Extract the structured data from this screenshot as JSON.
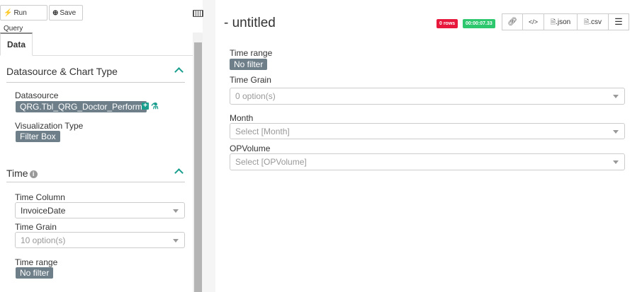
{
  "toolbar": {
    "run_query": "Run Query",
    "save": "Save"
  },
  "tabs": {
    "data": "Data"
  },
  "sections": {
    "datasource": {
      "title": "Datasource & Chart Type",
      "datasource_label": "Datasource",
      "datasource_value": "QRG.Tbl_QRG_Doctor_Perform",
      "viz_label": "Visualization Type",
      "viz_value": "Filter Box"
    },
    "time": {
      "title": "Time",
      "time_column_label": "Time Column",
      "time_column_value": "InvoiceDate",
      "time_grain_label": "Time Grain",
      "time_grain_placeholder": "10 option(s)",
      "time_range_label": "Time range",
      "time_range_value": "No filter"
    }
  },
  "main": {
    "title": "- untitled",
    "rows_badge": "0 rows",
    "timer_badge": "00:00:07.33",
    "actions": {
      "json": ".json",
      "csv": ".csv"
    },
    "time_range_label": "Time range",
    "time_range_value": "No filter",
    "time_grain_label": "Time Grain",
    "time_grain_placeholder": "0 option(s)",
    "month_label": "Month",
    "month_placeholder": "Select [Month]",
    "opvolume_label": "OPVolume",
    "opvolume_placeholder": "Select [OPVolume]"
  },
  "colors": {
    "accent": "#1a9e8e",
    "tag": "#6e7f8a",
    "danger": "#e8173c",
    "success": "#2dc76d"
  },
  "icons": [
    "bolt-icon",
    "plus-circle-icon",
    "keyboard-icon",
    "info-icon",
    "chevron-up-icon",
    "plus-square-icon",
    "flask-icon",
    "link-icon",
    "code-icon",
    "file-icon",
    "menu-icon",
    "caret-down-icon"
  ]
}
